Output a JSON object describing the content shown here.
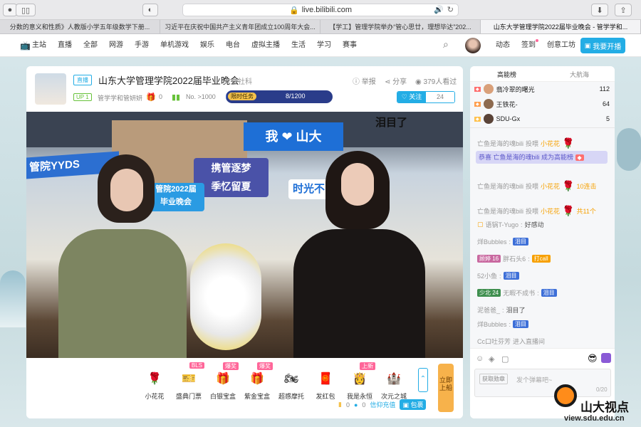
{
  "browser": {
    "url": "live.bilibili.com",
    "tabs": [
      "分数的意义和性质》人教版小学五年级数学下册...",
      "习近平在庆祝中国共产主义青年团成立100周年大会...",
      "【学工】管理学院举办“管心思廿，理想毕达”202...",
      "山东大学管理学院2022届毕业晚会 - 管学学和..."
    ]
  },
  "nav": {
    "items": [
      "主站",
      "直播",
      "全部",
      "网游",
      "手游",
      "单机游戏",
      "娱乐",
      "电台",
      "虚拟主播",
      "生活",
      "学习",
      "赛事"
    ],
    "right": [
      "动态",
      "签到",
      "创意工坊"
    ],
    "open_live": "我要开播"
  },
  "room": {
    "live_badge": "直播",
    "title": "山东大学管理学院2022届毕业晚会",
    "category": "人文社科",
    "report": "举报",
    "share": "分享",
    "viewers": "379人看过",
    "up_level": "UP 1",
    "streamer": "管学学和管妍妍",
    "gift_count": "0",
    "rank": "No. >1000",
    "task_label": "限时任务",
    "task_progress": "8/1200",
    "task_fraction": 0.0067,
    "follow": "关注",
    "follow_count": "24"
  },
  "video": {
    "caption": "泪目了",
    "sign_left": "管院YYDS",
    "sign_center": "管院2022届\n毕业晚会",
    "sign_slogan": "携管逐梦\n季忆留夏",
    "sign_heart": "我 ❤ 山大",
    "sign_right": "时光不"
  },
  "gifts": [
    {
      "name": "小花花",
      "icon": "🌹",
      "tag": ""
    },
    {
      "name": "盛典门票",
      "icon": "🎫",
      "tag": "BLS"
    },
    {
      "name": "白银宝盒",
      "icon": "🎁",
      "tag": "爆奖"
    },
    {
      "name": "紫金宝盒",
      "icon": "🎁",
      "tag": "爆奖"
    },
    {
      "name": "超感摩托",
      "icon": "🏍",
      "tag": ""
    },
    {
      "name": "发红包",
      "icon": "🧧",
      "tag": ""
    },
    {
      "name": "我是永恒",
      "icon": "👸",
      "tag": "上新"
    },
    {
      "name": "次元之城",
      "icon": "🏰",
      "tag": ""
    }
  ],
  "gift_bar": {
    "up_board": "立即上船",
    "battery": "0",
    "silver": "0",
    "recharge": "信仰充值",
    "bag": "包裹"
  },
  "side": {
    "tab_high": "高能榜",
    "tab_fleet": "大航海",
    "rank": [
      {
        "name": "翡冷翠的曙光",
        "value": "112"
      },
      {
        "name": "王铁花-",
        "value": "64"
      },
      {
        "name": "SDU-Gx",
        "value": "5"
      }
    ],
    "messages": [
      {
        "type": "gift",
        "user": "亡鱼是海的魂bili",
        "action": "投喂",
        "gift": "小花花",
        "extra": ""
      },
      {
        "type": "notice",
        "text": "恭喜 亡鱼是海的魂bili 成为高能榜"
      },
      {
        "type": "gift",
        "user": "亡鱼是海的魂bili",
        "action": "投喂",
        "gift": "小花花",
        "extra": "10连击"
      },
      {
        "type": "gift",
        "user": "亡鱼是海的魂bili",
        "action": "投喂",
        "gift": "小花花",
        "extra": "共11个"
      },
      {
        "type": "chat",
        "user": "语锅T-Yugo",
        "text": "好感动"
      },
      {
        "type": "chat",
        "user": "烊Bubbles",
        "text": "泪目"
      },
      {
        "type": "chat",
        "medal": "顾婷",
        "medal_level": "16",
        "user": "胖石头6",
        "text": "打call"
      },
      {
        "type": "chat",
        "user": "52小鱼",
        "text": "泪目"
      },
      {
        "type": "chat",
        "medal": "少北",
        "medal_level": "24",
        "user": "无暇不成书",
        "text": "泪目"
      },
      {
        "type": "chat",
        "user": "泥爸爸_",
        "text": "泪目了"
      },
      {
        "type": "chat",
        "user": "烊Bubbles",
        "text": "泪目"
      },
      {
        "type": "enter",
        "user": "Cc口吐芬芳",
        "text": "进入直播间"
      }
    ],
    "medal_btn": "获取勋章",
    "input_placeholder": "发个弹幕吧~",
    "char_count": "0/20"
  },
  "watermark": {
    "brand": "山大视点",
    "url": "view.sdu.edu.cn"
  }
}
